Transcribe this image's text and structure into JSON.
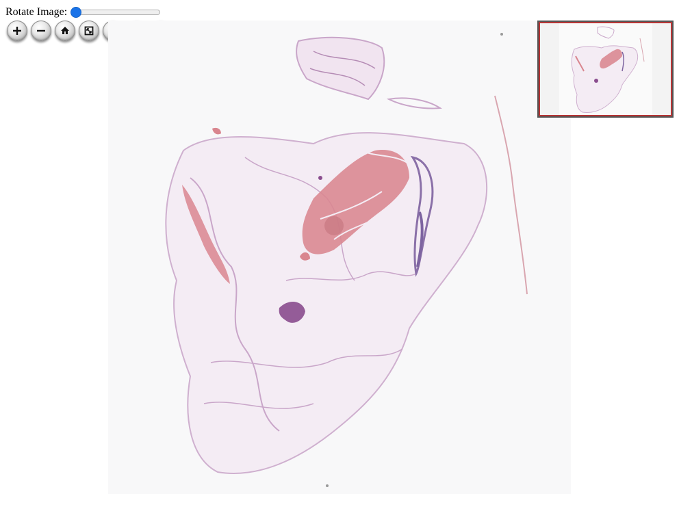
{
  "rotate": {
    "label": "Rotate Image:",
    "value": 0
  },
  "toolbar": {
    "buttons": [
      {
        "name": "zoom-in",
        "icon": "plus-icon"
      },
      {
        "name": "zoom-out",
        "icon": "minus-icon"
      },
      {
        "name": "home",
        "icon": "home-icon"
      },
      {
        "name": "full-page",
        "icon": "fullscreen-icon"
      },
      {
        "name": "rotate-left",
        "icon": "rotate-left-icon"
      },
      {
        "name": "rotate-right",
        "icon": "rotate-right-icon"
      },
      {
        "name": "flip",
        "icon": "flip-icon"
      }
    ]
  },
  "colors": {
    "slider_thumb": "#1a73e8",
    "navigator_box": "#b53535",
    "tissue_stroma": "#c9a6c9",
    "tissue_muscle": "#d9868f",
    "tissue_nuclei": "#8a4d8e"
  }
}
